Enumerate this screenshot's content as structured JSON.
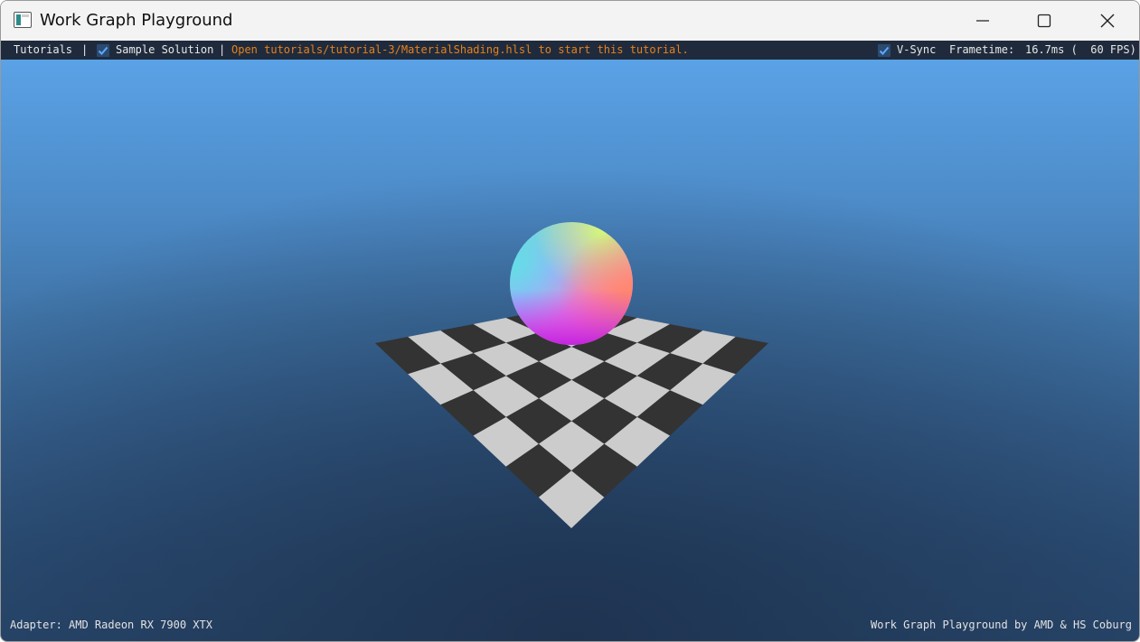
{
  "window": {
    "title": "Work Graph Playground"
  },
  "menubar": {
    "tutorials_label": "Tutorials",
    "separator_1": "|",
    "sample_solution_label": "Sample Solution",
    "sample_solution_checked": true,
    "separator_2": "|",
    "hint_text": "Open tutorials/tutorial-3/MaterialShading.hlsl to start this tutorial.",
    "hint_color": "#e8801a",
    "vsync_label": "V-Sync",
    "vsync_checked": true,
    "frametime_label": "Frametime:",
    "frametime_value": "16.7ms (  60 FPS)"
  },
  "footer": {
    "adapter_text": "Adapter: AMD Radeon RX 7900 XTX",
    "credit_text": "Work Graph Playground by AMD & HS Coburg"
  },
  "scene": {
    "floor_light_color": "#cccccc",
    "floor_dark_color": "#333333",
    "sky_top_color": "#5aa2e6",
    "sky_bottom_color": "#294a70"
  }
}
